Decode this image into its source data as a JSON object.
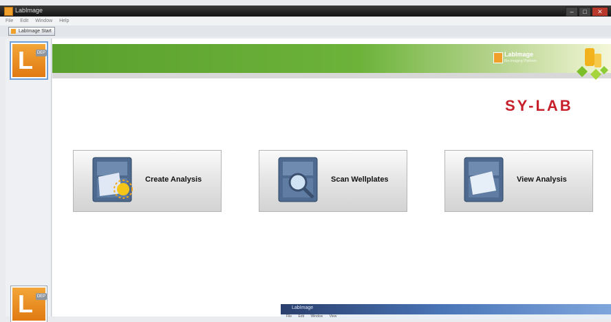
{
  "window": {
    "title": "LabImage"
  },
  "menubar": [
    "File",
    "Edit",
    "Window",
    "Help"
  ],
  "tab": {
    "label": "LabImage Start"
  },
  "sidebar": {
    "top_icon_tag": "DEP",
    "bottom_icon_tag": "DEP"
  },
  "banner": {
    "brand": "LabImage",
    "subtitle": "Bio-Imaging Platform",
    "sylab": "SY-LAB"
  },
  "actions": [
    {
      "label": "Create Analysis",
      "icon": "cabinet-sun-icon"
    },
    {
      "label": "Scan Wellplates",
      "icon": "cabinet-magnifier-icon"
    },
    {
      "label": "View Analysis",
      "icon": "cabinet-document-icon"
    }
  ],
  "overlay_window": {
    "title": "LabImage",
    "menu": [
      "File",
      "Edit",
      "Window",
      "View"
    ]
  },
  "colors": {
    "brand_orange": "#f0a02a",
    "banner_green": "#5aa02e",
    "sylab_red": "#c8202a"
  }
}
